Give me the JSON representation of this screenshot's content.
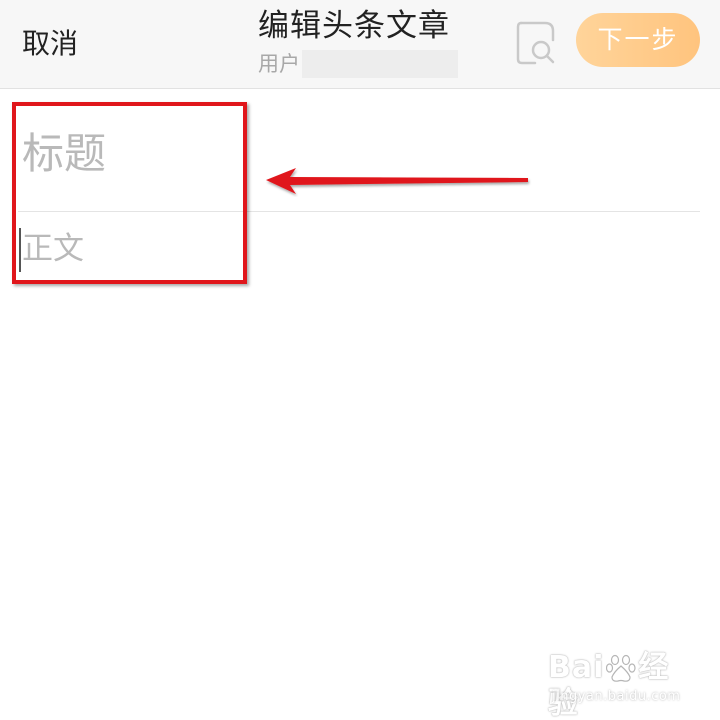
{
  "header": {
    "cancel_label": "取消",
    "title": "编辑头条文章",
    "subtitle_label": "用户",
    "next_label": "下一步",
    "preview_icon": "search-preview-icon"
  },
  "editor": {
    "title_placeholder": "标题",
    "body_placeholder": "正文"
  },
  "annotation": {
    "box_color": "#e0161b",
    "arrow_color": "#e0161b"
  },
  "watermark": {
    "brand": "Bai",
    "brand_suffix": "经验",
    "url": "jingyan.baidu.com"
  },
  "colors": {
    "accent": "#ffc47e",
    "header_bg": "#f7f7f7",
    "placeholder": "#b9b9b9"
  }
}
